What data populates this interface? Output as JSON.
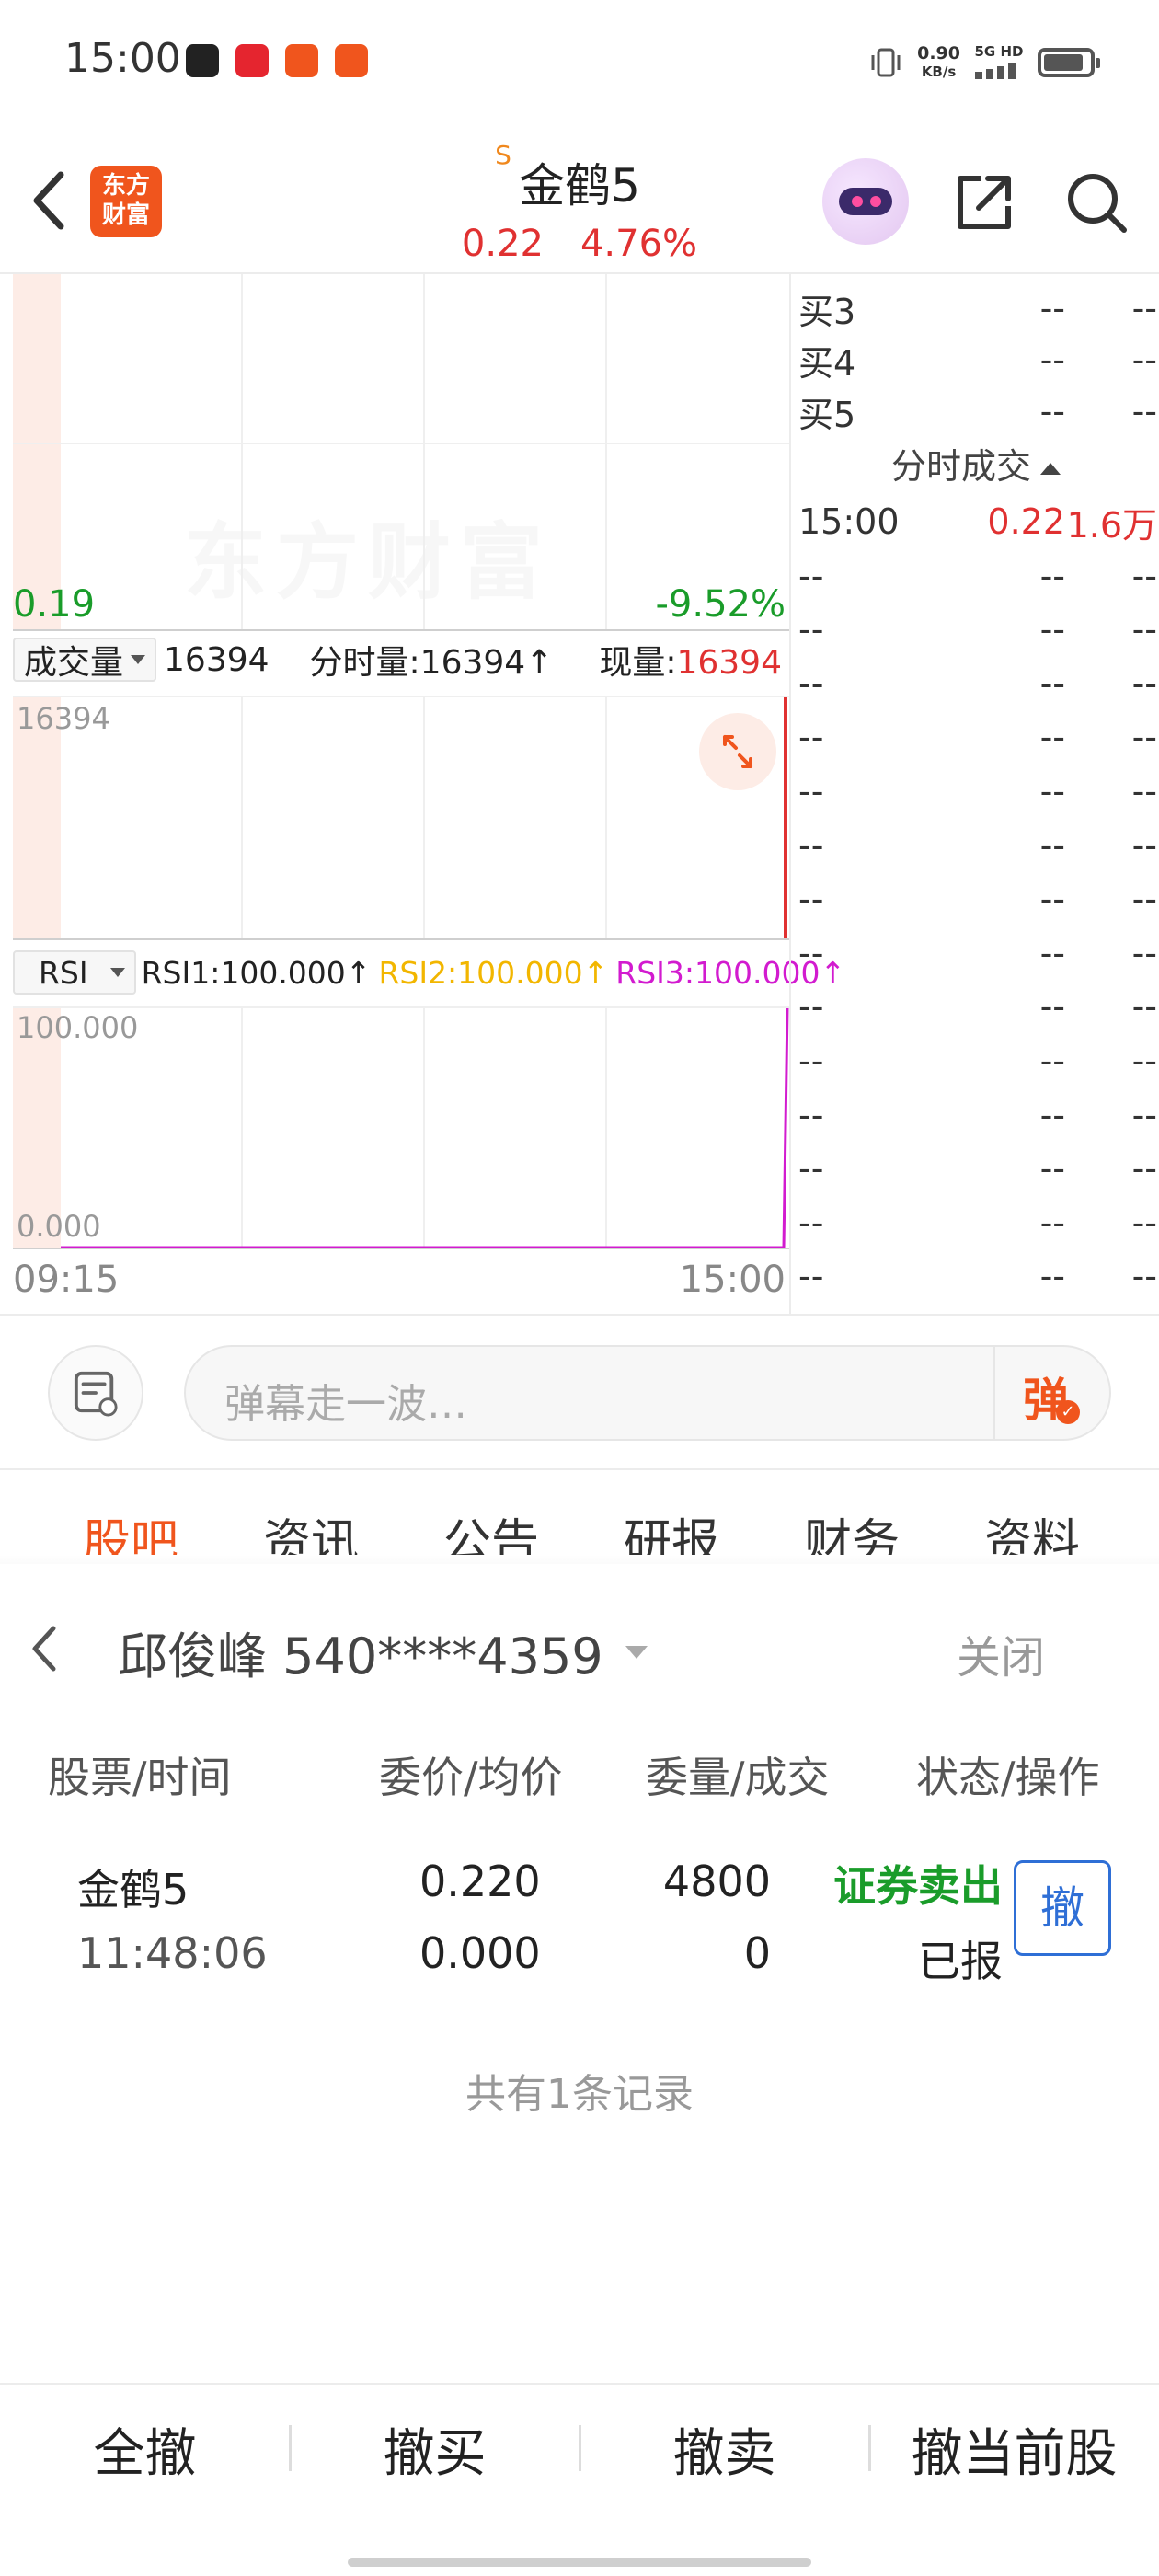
{
  "status_bar": {
    "time": "15:00",
    "net_speed": "0.90",
    "net_unit": "KB/s",
    "net_type": "5G HD",
    "battery_level": 0.75
  },
  "header": {
    "logo_line1": "东方",
    "logo_line2": "财富",
    "s_mark": "S",
    "stock_name": "金鹤5",
    "price": "0.22",
    "change_pct": "4.76%"
  },
  "chart": {
    "low_price": "0.19",
    "low_pct": "-9.52%",
    "volume_selector": "成交量",
    "volume_value": "16394",
    "minute_volume": "分时量:16394↑",
    "current_volume_label": "现量:",
    "current_volume": "16394",
    "volume_max": "16394",
    "rsi_selector": "RSI",
    "rsi1": "RSI1:100.000↑",
    "rsi2": "RSI2:100.000↑",
    "rsi3": "RSI3:100.000↑",
    "rsi_max": "100.000",
    "rsi_min": "0.000",
    "time_start": "09:15",
    "time_end": "15:00"
  },
  "order_book": {
    "bids": [
      {
        "label": "买3",
        "price": "--",
        "volume": "--"
      },
      {
        "label": "买4",
        "price": "--",
        "volume": "--"
      },
      {
        "label": "买5",
        "price": "--",
        "volume": "--"
      }
    ],
    "ticks_title": "分时成交",
    "ticks": [
      {
        "time": "15:00",
        "price": "0.22",
        "volume": "1.6万"
      },
      {
        "time": "--",
        "price": "--",
        "volume": "--"
      },
      {
        "time": "--",
        "price": "--",
        "volume": "--"
      },
      {
        "time": "--",
        "price": "--",
        "volume": "--"
      },
      {
        "time": "--",
        "price": "--",
        "volume": "--"
      },
      {
        "time": "--",
        "price": "--",
        "volume": "--"
      },
      {
        "time": "--",
        "price": "--",
        "volume": "--"
      },
      {
        "time": "--",
        "price": "--",
        "volume": "--"
      },
      {
        "time": "--",
        "price": "--",
        "volume": "--"
      },
      {
        "time": "--",
        "price": "--",
        "volume": "--"
      },
      {
        "time": "--",
        "price": "--",
        "volume": "--"
      },
      {
        "time": "--",
        "price": "--",
        "volume": "--"
      },
      {
        "time": "--",
        "price": "--",
        "volume": "--"
      },
      {
        "time": "--",
        "price": "--",
        "volume": "--"
      },
      {
        "time": "--",
        "price": "--",
        "volume": "--"
      }
    ]
  },
  "comment": {
    "placeholder": "弹幕走一波…",
    "danmu_label": "弹"
  },
  "tabs": [
    "股吧",
    "资讯",
    "公告",
    "研报",
    "财务",
    "资料"
  ],
  "order_sheet": {
    "account": "邱俊峰 540****4359",
    "close_label": "关闭",
    "columns": [
      "股票/时间",
      "委价/均价",
      "委量/成交",
      "状态/操作"
    ],
    "order": {
      "stock": "金鹤5",
      "time": "11:48:06",
      "order_price": "0.220",
      "avg_price": "0.000",
      "order_qty": "4800",
      "filled_qty": "0",
      "direction": "证券卖出",
      "status": "已报",
      "cancel_label": "撤"
    },
    "record_count": "共有1条记录"
  },
  "bottom_actions": [
    "全撤",
    "撤买",
    "撤卖",
    "撤当前股"
  ],
  "colors": {
    "up": "#e03131",
    "down": "#1a9c2a",
    "brand": "#f0551d",
    "link": "#2f6fd6"
  }
}
